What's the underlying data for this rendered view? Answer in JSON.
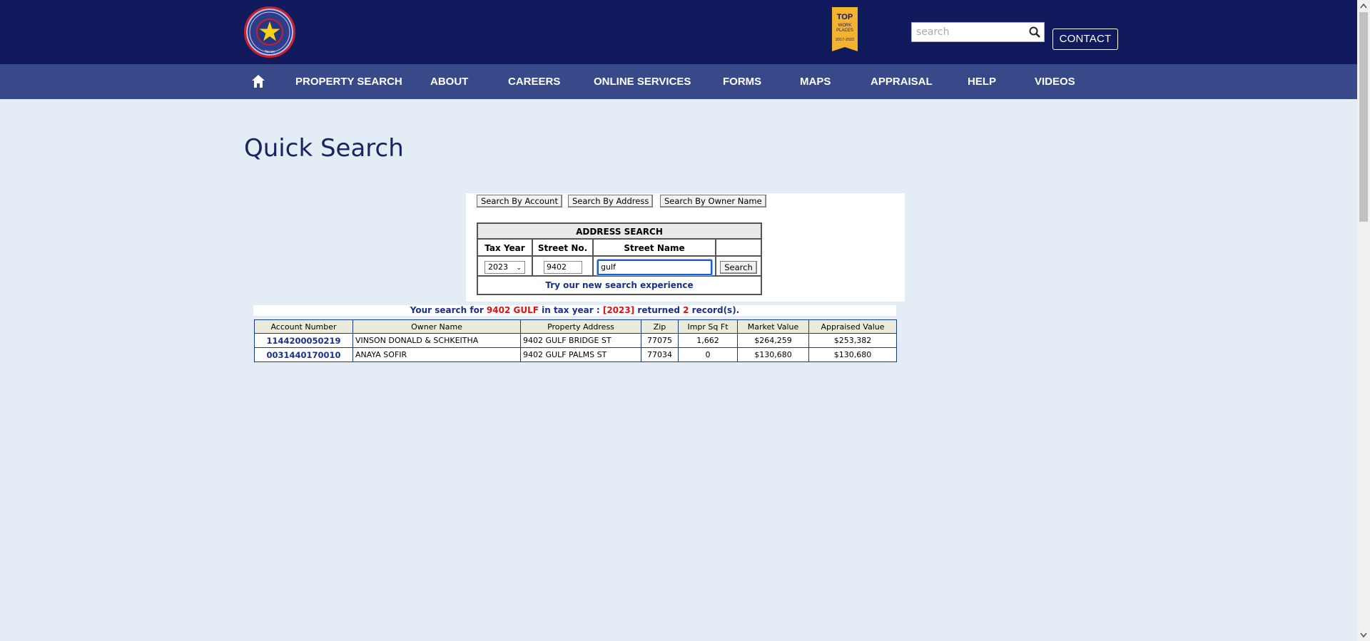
{
  "header": {
    "logo_text": [
      "HARRIS CENTRAL APPRAISAL DISTRICT",
      "Texas"
    ],
    "badge_text": [
      "TOP",
      "WORK",
      "PLACES",
      "2017-2022"
    ],
    "search_placeholder": "search",
    "contact_label": "CONTACT"
  },
  "nav": {
    "items": [
      "PROPERTY SEARCH",
      "ABOUT",
      "CAREERS",
      "ONLINE SERVICES",
      "FORMS",
      "MAPS",
      "APPRAISAL",
      "HELP",
      "VIDEOS"
    ]
  },
  "page_title": "Quick Search",
  "search_modes": [
    "Search By Account",
    "Search By Address",
    "Search By Owner Name"
  ],
  "address_search": {
    "heading": "ADDRESS SEARCH",
    "columns": [
      "Tax Year",
      "Street No.",
      "Street Name"
    ],
    "tax_year": "2023",
    "street_no": "9402",
    "street_name": "gulf",
    "search_label": "Search",
    "new_experience_link": "Try our new search experience"
  },
  "result_message": {
    "prefix": "Your search for ",
    "query": "9402 GULF",
    "middle": " in tax year : ",
    "year": "[2023]",
    "returned": " returned ",
    "count": "2",
    "suffix": " record(s)."
  },
  "results": {
    "headers": [
      "Account Number",
      "Owner Name",
      "Property Address",
      "Zip",
      "Impr Sq Ft",
      "Market Value",
      "Appraised Value"
    ],
    "rows": [
      [
        "1144200050219",
        "VINSON DONALD & SCHKEITHA",
        "9402 GULF BRIDGE ST",
        "77075",
        "1,662",
        "$264,259",
        "$253,382"
      ],
      [
        "0031440170010",
        "ANAYA SOFIR",
        "9402 GULF PALMS ST",
        "77034",
        "0",
        "$130,680",
        "$130,680"
      ]
    ]
  },
  "colors": {
    "header_bg": "#121a5e",
    "nav_bg": "#38498a",
    "page_bg": "#e4ecf5",
    "link_blue": "#1a2f8c",
    "highlight_red": "#dd1111"
  }
}
